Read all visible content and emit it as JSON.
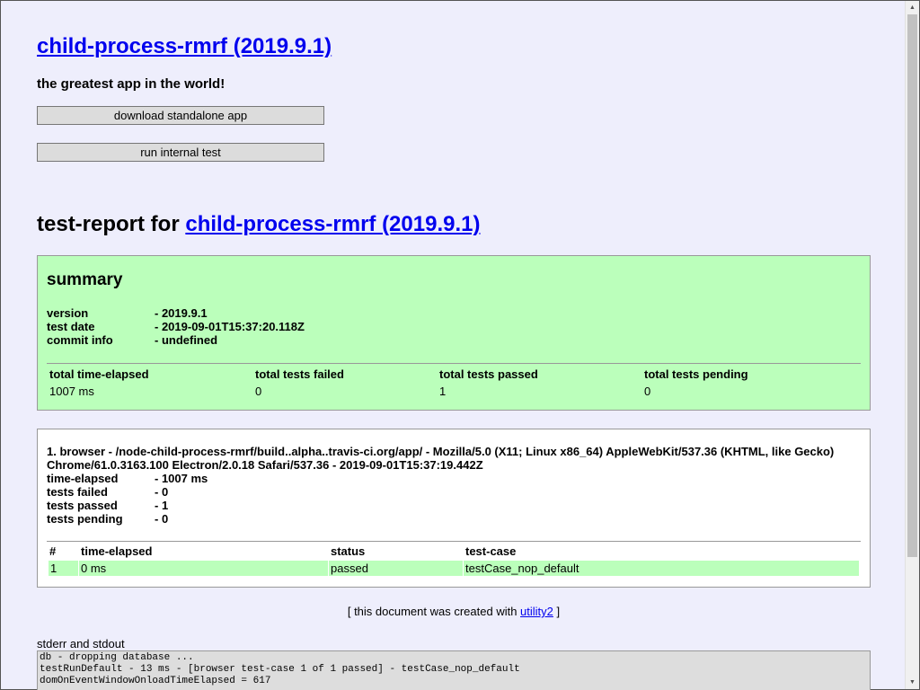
{
  "app": {
    "title": "child-process-rmrf (2019.9.1)",
    "tagline": "the greatest app in the world!",
    "download_label": "download standalone app",
    "run_test_label": "run internal test"
  },
  "report": {
    "title_prefix": "test-report for ",
    "title_link": "child-process-rmrf (2019.9.1)"
  },
  "summary": {
    "heading": "summary",
    "fields": [
      {
        "key": "version",
        "value": "- 2019.9.1"
      },
      {
        "key": "test date",
        "value": "- 2019-09-01T15:37:20.118Z"
      },
      {
        "key": "commit info",
        "value": "- undefined"
      }
    ],
    "columns": [
      "total time-elapsed",
      "total tests failed",
      "total tests passed",
      "total tests pending"
    ],
    "values": [
      "1007 ms",
      "0",
      "1",
      "0"
    ]
  },
  "browser": {
    "heading": "1. browser - /node-child-process-rmrf/build..alpha..travis-ci.org/app/ - Mozilla/5.0 (X11; Linux x86_64) AppleWebKit/537.36 (KHTML, like Gecko) Chrome/61.0.3163.100 Electron/2.0.18 Safari/537.36 - 2019-09-01T15:37:19.442Z",
    "fields": [
      {
        "key": "time-elapsed",
        "value": "- 1007 ms"
      },
      {
        "key": "tests failed",
        "value": "- 0"
      },
      {
        "key": "tests passed",
        "value": "- 1"
      },
      {
        "key": "tests pending",
        "value": "- 0"
      }
    ],
    "columns": [
      "#",
      "time-elapsed",
      "status",
      "test-case"
    ],
    "rows": [
      {
        "num": "1",
        "time": "0 ms",
        "status": "passed",
        "name": "testCase_nop_default"
      }
    ],
    "pass_color": "#bbffbb"
  },
  "footer": {
    "prefix": "[ this document was created with ",
    "link": "utility2",
    "suffix": " ]"
  },
  "stderr": {
    "label": "stderr and stdout",
    "lines": [
      "db - dropping database ...",
      "testRunDefault - 13 ms - [browser test-case 1 of 1 passed] - testCase_nop_default",
      "domOnEventWindowOnloadTimeElapsed = 617"
    ]
  },
  "scrollbar": {
    "up_icon": "triangle-up",
    "down_icon": "triangle-down"
  }
}
